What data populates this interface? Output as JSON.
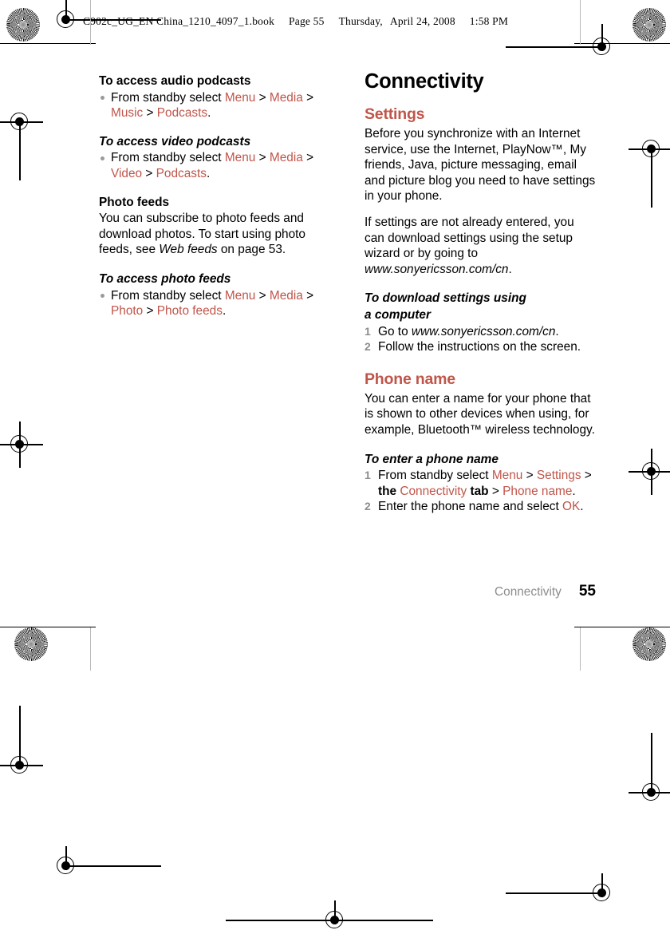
{
  "slug": {
    "filename": "C902c_UG_EN China_1210_4097_1.book",
    "page_label": "Page 55",
    "weekday": "Thursday,",
    "date": "April 24, 2008",
    "time": "1:58 PM"
  },
  "left_column": {
    "blocks": [
      {
        "heading": "To access audio podcasts",
        "heading_style": "bold",
        "bullet": {
          "lead": "From standby select ",
          "path": [
            "Menu",
            "Media",
            "Music",
            "Podcasts"
          ],
          "sep": " > ",
          "end": "."
        }
      },
      {
        "heading": "To access video podcasts",
        "heading_style": "bold-italic",
        "bullet": {
          "lead": "From standby select ",
          "path": [
            "Menu",
            "Media",
            "Video",
            "Podcasts"
          ],
          "sep": " > ",
          "end": "."
        }
      },
      {
        "heading": "Photo feeds",
        "heading_style": "bold",
        "paragraph_a": "You can subscribe to photo feeds and download photos. To start using photo feeds, see ",
        "paragraph_italic": "Web feeds",
        "paragraph_b": " on page 53."
      },
      {
        "heading": "To access photo feeds",
        "heading_style": "bold-italic",
        "bullet": {
          "lead": "From standby select ",
          "path": [
            "Menu",
            "Media",
            "Photo",
            "Photo feeds"
          ],
          "sep": " > ",
          "end": "."
        }
      }
    ]
  },
  "right_column": {
    "chapter_title": "Connectivity",
    "settings": {
      "heading": "Settings",
      "paragraph_1": "Before you synchronize with an Internet service, use the Internet, PlayNow™, My friends, Java, picture messaging, email and picture blog you need to have settings in your phone.",
      "paragraph_2_a": "If settings are not already entered, you can download settings using the setup wizard or by going to ",
      "paragraph_2_url": "www.sonyericsson.com/cn",
      "paragraph_2_b": "."
    },
    "download_procedure": {
      "heading_line1": "To download settings using",
      "heading_line2": "a computer",
      "steps": [
        {
          "num": "1",
          "lead": "Go to ",
          "url": "www.sonyericsson.com/cn",
          "tail": "."
        },
        {
          "num": "2",
          "lead": "Follow the instructions on the screen.",
          "url": "",
          "tail": ""
        }
      ]
    },
    "phone_name": {
      "heading": "Phone name",
      "paragraph": "You can enter a name for your phone that is shown to other devices when using, for example, Bluetooth™ wireless technology."
    },
    "enter_name_procedure": {
      "heading": "To enter a phone name",
      "step1": {
        "num": "1",
        "lead": "From standby select ",
        "link_menu": "Menu",
        "sep1": " > ",
        "link_settings": "Settings",
        "sep2": " > ",
        "word_the": "the",
        "link_connectivity": "Connectivity",
        "word_tab": "tab",
        "sep3": " > ",
        "link_phone_name": "Phone name",
        "end": "."
      },
      "step2": {
        "num": "2",
        "lead": "Enter the phone name and select ",
        "link_ok": "OK",
        "end": "."
      }
    }
  },
  "footer": {
    "chapter": "Connectivity",
    "page_number": "55"
  },
  "colors": {
    "accent": "#C0554A",
    "muted": "#8d8d8d",
    "bullet": "#9a9a9a",
    "text": "#000000"
  },
  "marks": {
    "starburst": "registration-starburst",
    "target": "registration-target",
    "crop": "crop-rule"
  }
}
